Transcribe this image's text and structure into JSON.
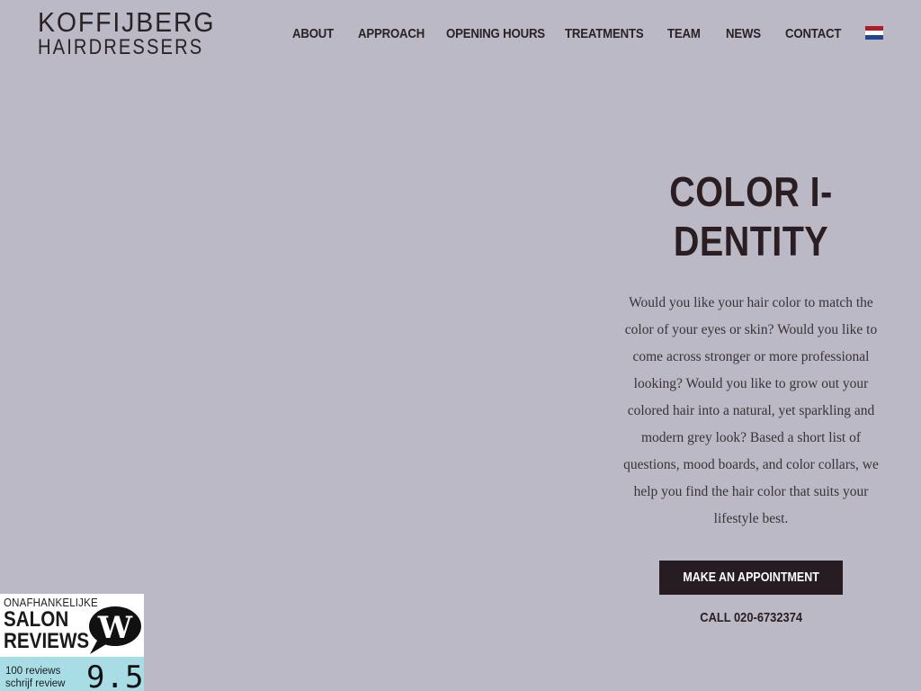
{
  "logo": {
    "line1": "KOFFIJBERG",
    "line2": "HAIRDRESSERS"
  },
  "nav": {
    "items": [
      {
        "label": "About"
      },
      {
        "label": "Approach"
      },
      {
        "label": "Opening hours"
      },
      {
        "label": "Treatments"
      },
      {
        "label": "Team"
      },
      {
        "label": "News"
      },
      {
        "label": "Contact"
      }
    ],
    "language_flag": "netherlands-flag-icon",
    "flag_colors": [
      "#ae1c28",
      "#ffffff",
      "#21468b"
    ]
  },
  "hero": {
    "title_line1": "COLOR I-",
    "title_line2": "DENTITY",
    "description": "Would you like your hair color to match the color of your eyes or skin? Would you like to come across stronger or more professional looking? Would you like to grow out your colored hair into a natural, yet sparkling and modern grey look? Based a short list of questions, mood boards, and color collars, we help you find the hair color that suits your lifestyle best.",
    "cta_label": "MAKE AN APPOINTMENT",
    "phone_label": "CALL 020-6732374"
  },
  "review_widget": {
    "line1": "ONAFHANKELIJKE",
    "line2": "SALON",
    "line3": "REVIEWS",
    "logo_letter": "W",
    "count": "100 reviews",
    "write": "schrijf review",
    "score": "9.5",
    "accent": "#a9dde6"
  },
  "colors": {
    "background": "#bbb9c6",
    "dark": "#271c21"
  }
}
